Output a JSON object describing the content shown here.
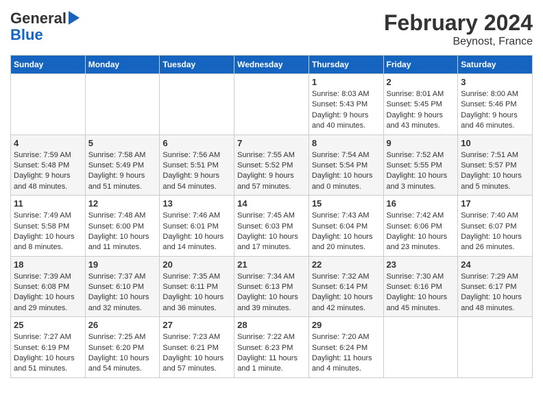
{
  "header": {
    "logo_line1": "General",
    "logo_line2": "Blue",
    "title": "February 2024",
    "subtitle": "Beynost, France"
  },
  "days_of_week": [
    "Sunday",
    "Monday",
    "Tuesday",
    "Wednesday",
    "Thursday",
    "Friday",
    "Saturday"
  ],
  "weeks": [
    [
      {
        "day": "",
        "info": ""
      },
      {
        "day": "",
        "info": ""
      },
      {
        "day": "",
        "info": ""
      },
      {
        "day": "",
        "info": ""
      },
      {
        "day": "1",
        "info": "Sunrise: 8:03 AM\nSunset: 5:43 PM\nDaylight: 9 hours\nand 40 minutes."
      },
      {
        "day": "2",
        "info": "Sunrise: 8:01 AM\nSunset: 5:45 PM\nDaylight: 9 hours\nand 43 minutes."
      },
      {
        "day": "3",
        "info": "Sunrise: 8:00 AM\nSunset: 5:46 PM\nDaylight: 9 hours\nand 46 minutes."
      }
    ],
    [
      {
        "day": "4",
        "info": "Sunrise: 7:59 AM\nSunset: 5:48 PM\nDaylight: 9 hours\nand 48 minutes."
      },
      {
        "day": "5",
        "info": "Sunrise: 7:58 AM\nSunset: 5:49 PM\nDaylight: 9 hours\nand 51 minutes."
      },
      {
        "day": "6",
        "info": "Sunrise: 7:56 AM\nSunset: 5:51 PM\nDaylight: 9 hours\nand 54 minutes."
      },
      {
        "day": "7",
        "info": "Sunrise: 7:55 AM\nSunset: 5:52 PM\nDaylight: 9 hours\nand 57 minutes."
      },
      {
        "day": "8",
        "info": "Sunrise: 7:54 AM\nSunset: 5:54 PM\nDaylight: 10 hours\nand 0 minutes."
      },
      {
        "day": "9",
        "info": "Sunrise: 7:52 AM\nSunset: 5:55 PM\nDaylight: 10 hours\nand 3 minutes."
      },
      {
        "day": "10",
        "info": "Sunrise: 7:51 AM\nSunset: 5:57 PM\nDaylight: 10 hours\nand 5 minutes."
      }
    ],
    [
      {
        "day": "11",
        "info": "Sunrise: 7:49 AM\nSunset: 5:58 PM\nDaylight: 10 hours\nand 8 minutes."
      },
      {
        "day": "12",
        "info": "Sunrise: 7:48 AM\nSunset: 6:00 PM\nDaylight: 10 hours\nand 11 minutes."
      },
      {
        "day": "13",
        "info": "Sunrise: 7:46 AM\nSunset: 6:01 PM\nDaylight: 10 hours\nand 14 minutes."
      },
      {
        "day": "14",
        "info": "Sunrise: 7:45 AM\nSunset: 6:03 PM\nDaylight: 10 hours\nand 17 minutes."
      },
      {
        "day": "15",
        "info": "Sunrise: 7:43 AM\nSunset: 6:04 PM\nDaylight: 10 hours\nand 20 minutes."
      },
      {
        "day": "16",
        "info": "Sunrise: 7:42 AM\nSunset: 6:06 PM\nDaylight: 10 hours\nand 23 minutes."
      },
      {
        "day": "17",
        "info": "Sunrise: 7:40 AM\nSunset: 6:07 PM\nDaylight: 10 hours\nand 26 minutes."
      }
    ],
    [
      {
        "day": "18",
        "info": "Sunrise: 7:39 AM\nSunset: 6:08 PM\nDaylight: 10 hours\nand 29 minutes."
      },
      {
        "day": "19",
        "info": "Sunrise: 7:37 AM\nSunset: 6:10 PM\nDaylight: 10 hours\nand 32 minutes."
      },
      {
        "day": "20",
        "info": "Sunrise: 7:35 AM\nSunset: 6:11 PM\nDaylight: 10 hours\nand 36 minutes."
      },
      {
        "day": "21",
        "info": "Sunrise: 7:34 AM\nSunset: 6:13 PM\nDaylight: 10 hours\nand 39 minutes."
      },
      {
        "day": "22",
        "info": "Sunrise: 7:32 AM\nSunset: 6:14 PM\nDaylight: 10 hours\nand 42 minutes."
      },
      {
        "day": "23",
        "info": "Sunrise: 7:30 AM\nSunset: 6:16 PM\nDaylight: 10 hours\nand 45 minutes."
      },
      {
        "day": "24",
        "info": "Sunrise: 7:29 AM\nSunset: 6:17 PM\nDaylight: 10 hours\nand 48 minutes."
      }
    ],
    [
      {
        "day": "25",
        "info": "Sunrise: 7:27 AM\nSunset: 6:19 PM\nDaylight: 10 hours\nand 51 minutes."
      },
      {
        "day": "26",
        "info": "Sunrise: 7:25 AM\nSunset: 6:20 PM\nDaylight: 10 hours\nand 54 minutes."
      },
      {
        "day": "27",
        "info": "Sunrise: 7:23 AM\nSunset: 6:21 PM\nDaylight: 10 hours\nand 57 minutes."
      },
      {
        "day": "28",
        "info": "Sunrise: 7:22 AM\nSunset: 6:23 PM\nDaylight: 11 hours\nand 1 minute."
      },
      {
        "day": "29",
        "info": "Sunrise: 7:20 AM\nSunset: 6:24 PM\nDaylight: 11 hours\nand 4 minutes."
      },
      {
        "day": "",
        "info": ""
      },
      {
        "day": "",
        "info": ""
      }
    ]
  ]
}
